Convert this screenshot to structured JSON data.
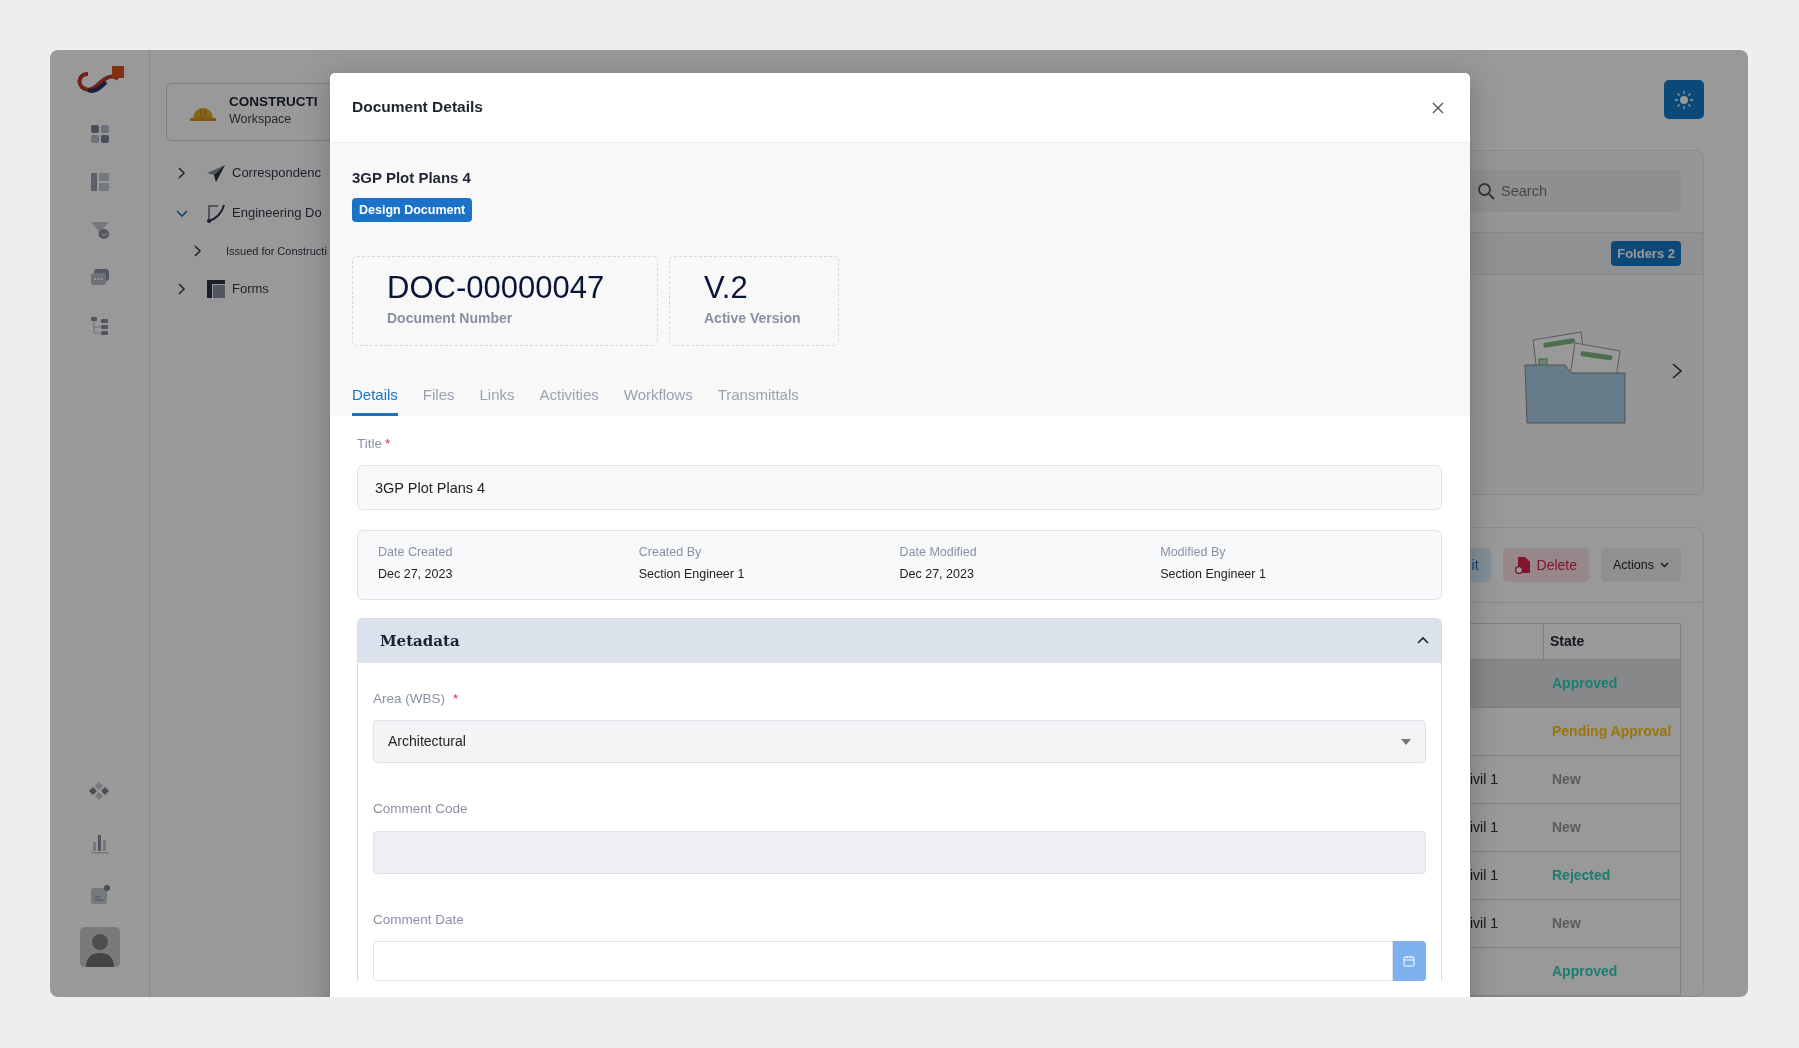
{
  "workspace": {
    "name": "CONSTRUCTI",
    "subtitle": "Workspace"
  },
  "tree": [
    {
      "label": "Correspondenc",
      "kind": "send",
      "expanded": false
    },
    {
      "label": "Engineering Do",
      "kind": "curve",
      "expanded": true,
      "children": [
        {
          "label": "Issued for Constructi",
          "expanded": false
        }
      ]
    },
    {
      "label": "Forms",
      "kind": "forms",
      "expanded": false
    }
  ],
  "search": {
    "placeholder": "Search"
  },
  "folders": {
    "badge": "Folders 2"
  },
  "toolbar": [
    {
      "kind": "submit",
      "label": "it"
    },
    {
      "kind": "delete",
      "label": "Delete"
    },
    {
      "kind": "menu",
      "label": "Actions"
    }
  ],
  "table": {
    "columns": [
      "State"
    ],
    "rows": [
      {
        "selected": true,
        "state": "Approved",
        "color": "#1b7d6e"
      },
      {
        "selected": false,
        "state": "Pending Approval",
        "color": "#9a7608"
      },
      {
        "selected": false,
        "column_2": "ivil 1",
        "state": "New",
        "color": "#5a5c5e"
      },
      {
        "selected": false,
        "column_2": "ivil 1",
        "state": "New",
        "color": "#5a5c5e"
      },
      {
        "selected": false,
        "column_2": "ivil 1",
        "state": "Rejected",
        "color": "#1b7d6e"
      },
      {
        "selected": false,
        "column_2": "ivil 1",
        "state": "New",
        "color": "#5a5c5e"
      },
      {
        "selected": false,
        "state": "Approved",
        "color": "#1b7d6e"
      }
    ]
  },
  "modal": {
    "title": "Document Details",
    "document_title": "3GP Plot Plans 4",
    "type_badge": "Design Document",
    "stats": [
      {
        "value": "DOC-00000047",
        "label": "Document Number"
      },
      {
        "value": "V.2",
        "label": "Active Version"
      }
    ],
    "tabs": [
      {
        "label": "Details",
        "selected": true
      },
      {
        "label": "Files",
        "selected": false
      },
      {
        "label": "Links",
        "selected": false
      },
      {
        "label": "Activities",
        "selected": false
      },
      {
        "label": "Workflows",
        "selected": false
      },
      {
        "label": "Transmittals",
        "selected": false
      }
    ],
    "title_field": {
      "label": "Title",
      "required_mark": "*",
      "value": "3GP Plot Plans 4"
    },
    "info": [
      {
        "label": "Date Created",
        "value": "Dec 27, 2023"
      },
      {
        "label": "Created By",
        "value": "Section Engineer 1"
      },
      {
        "label": "Date Modified",
        "value": "Dec 27, 2023"
      },
      {
        "label": "Modified By",
        "value": "Section Engineer 1"
      }
    ],
    "metadata": {
      "title": "Metadata",
      "expanded": true,
      "fields": [
        {
          "kind": "select",
          "label": "Area (WBS)",
          "required_mark": "*",
          "value": "Architectural"
        },
        {
          "kind": "text",
          "label": "Comment Code",
          "disabled": true
        },
        {
          "kind": "date",
          "label": "Comment Date",
          "disabled": false
        }
      ]
    }
  }
}
